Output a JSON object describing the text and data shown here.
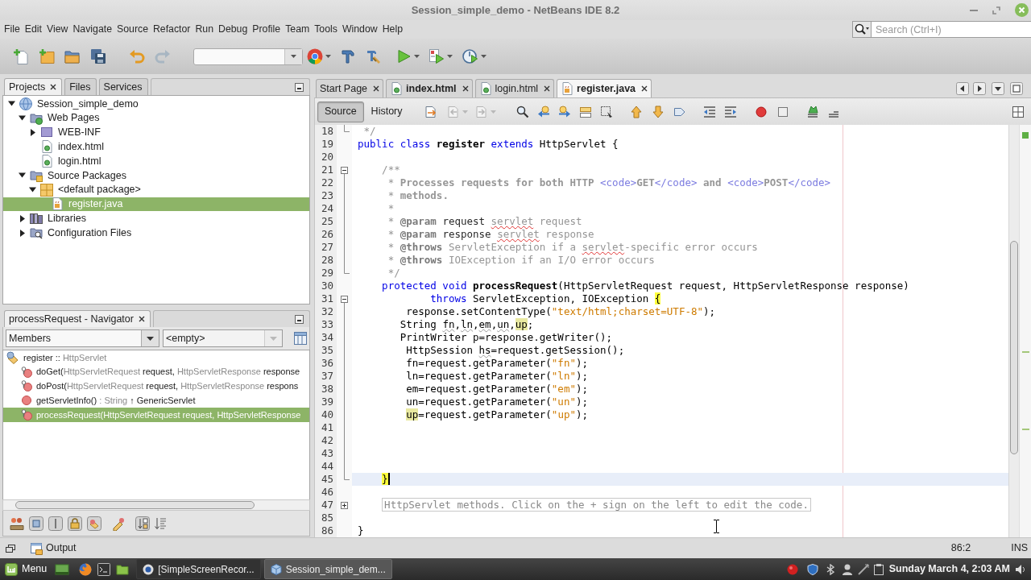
{
  "window": {
    "title": "Session_simple_demo - NetBeans IDE 8.2"
  },
  "menu": [
    "File",
    "Edit",
    "View",
    "Navigate",
    "Source",
    "Refactor",
    "Run",
    "Debug",
    "Profile",
    "Team",
    "Tools",
    "Window",
    "Help"
  ],
  "search": {
    "placeholder": "Search (Ctrl+I)"
  },
  "projects": {
    "tabs": [
      {
        "label": "Projects",
        "selected": true
      },
      {
        "label": "Files",
        "selected": false
      },
      {
        "label": "Services",
        "selected": false
      }
    ],
    "tree": [
      {
        "label": "Session_simple_demo",
        "kind": "project",
        "expanded": true,
        "selected": false,
        "children": [
          {
            "label": "Web Pages",
            "kind": "web_pages",
            "expanded": true,
            "selected": false,
            "children": [
              {
                "label": "WEB-INF",
                "kind": "folder",
                "expanded": false,
                "selected": false
              },
              {
                "label": "index.html",
                "kind": "html",
                "selected": false
              },
              {
                "label": "login.html",
                "kind": "html",
                "selected": false
              }
            ]
          },
          {
            "label": "Source Packages",
            "kind": "source_packages",
            "expanded": true,
            "selected": false,
            "children": [
              {
                "label": "<default package>",
                "kind": "package",
                "expanded": true,
                "selected": false,
                "children": [
                  {
                    "label": "register.java",
                    "kind": "java",
                    "selected": true
                  }
                ]
              }
            ]
          },
          {
            "label": "Libraries",
            "kind": "libraries",
            "expanded": false,
            "selected": false
          },
          {
            "label": "Configuration Files",
            "kind": "config",
            "expanded": false,
            "selected": false
          }
        ]
      }
    ]
  },
  "navigator": {
    "title": "processRequest - Navigator",
    "filter": {
      "value": "Members"
    },
    "scope": {
      "value": "<empty>",
      "disabled": true
    },
    "items": [
      {
        "kind": "class",
        "selected": false,
        "parts": [
          {
            "text": "register :: ",
            "kind": "name"
          },
          {
            "text": "HttpServlet",
            "kind": "type"
          }
        ],
        "children": [
          {
            "kind": "protected_method",
            "selected": false,
            "parts": [
              {
                "text": "doGet(",
                "kind": "name"
              },
              {
                "text": "HttpServletRequest",
                "kind": "type"
              },
              {
                "text": " request, ",
                "kind": "name"
              },
              {
                "text": "HttpServletResponse",
                "kind": "type"
              },
              {
                "text": " response",
                "kind": "name"
              }
            ]
          },
          {
            "kind": "protected_method",
            "selected": false,
            "parts": [
              {
                "text": "doPost(",
                "kind": "name"
              },
              {
                "text": "HttpServletRequest",
                "kind": "type"
              },
              {
                "text": " request, ",
                "kind": "name"
              },
              {
                "text": "HttpServletResponse",
                "kind": "type"
              },
              {
                "text": " respons",
                "kind": "name"
              }
            ]
          },
          {
            "kind": "public_method",
            "selected": false,
            "parts": [
              {
                "text": "getServletInfo() ",
                "kind": "name"
              },
              {
                "text": ": String ",
                "kind": "type"
              },
              {
                "text": "↑ GenericServlet",
                "kind": "name"
              }
            ]
          },
          {
            "kind": "protected_method",
            "selected": true,
            "parts": [
              {
                "text": "processRequest(",
                "kind": "name"
              },
              {
                "text": "HttpServletRequest",
                "kind": "type"
              },
              {
                "text": " request, ",
                "kind": "name"
              },
              {
                "text": "HttpServletResponse",
                "kind": "type"
              }
            ]
          }
        ]
      }
    ]
  },
  "editor": {
    "tabs": [
      {
        "label": "Start Page",
        "kind": "page",
        "selected": false,
        "modified": false
      },
      {
        "label": "index.html",
        "kind": "html",
        "selected": false,
        "modified": true
      },
      {
        "label": "login.html",
        "kind": "html",
        "selected": false,
        "modified": false
      },
      {
        "label": "register.java",
        "kind": "java",
        "selected": true,
        "modified": true
      }
    ],
    "views": [
      {
        "label": "Source",
        "selected": true
      },
      {
        "label": "History",
        "selected": false
      }
    ],
    "lines": [
      {
        "number": "18",
        "kind": "fold_end",
        "current": false,
        "tokens": [
          {
            "text": " */",
            "kind": "comment"
          }
        ]
      },
      {
        "number": "19",
        "kind": "code",
        "current": false,
        "tokens": [
          {
            "text": "public class ",
            "kind": "keyword"
          },
          {
            "text": "register",
            "kind": "decl"
          },
          {
            "text": " extends ",
            "kind": "keyword"
          },
          {
            "text": "HttpServlet {",
            "kind": "plain"
          }
        ]
      },
      {
        "number": "20",
        "kind": "code",
        "current": false
      },
      {
        "number": "21",
        "kind": "fold_start",
        "current": false,
        "tokens": [
          {
            "text": "    /**",
            "kind": "comment"
          }
        ]
      },
      {
        "number": "22",
        "kind": "code",
        "current": false,
        "tokens": [
          {
            "text": "     * ",
            "kind": "comment"
          },
          {
            "text": "Processes requests for both HTTP ",
            "kind": "comment_bold"
          },
          {
            "text": "<code>",
            "kind": "html_tag"
          },
          {
            "text": "GET",
            "kind": "comment_bold"
          },
          {
            "text": "</code>",
            "kind": "html_tag"
          },
          {
            "text": " and ",
            "kind": "comment_bold"
          },
          {
            "text": "<code>",
            "kind": "html_tag"
          },
          {
            "text": "POST",
            "kind": "comment_bold"
          },
          {
            "text": "</code>",
            "kind": "html_tag"
          }
        ]
      },
      {
        "number": "23",
        "kind": "code",
        "current": false,
        "tokens": [
          {
            "text": "     * ",
            "kind": "comment"
          },
          {
            "text": "methods.",
            "kind": "comment_bold"
          }
        ]
      },
      {
        "number": "24",
        "kind": "code",
        "current": false,
        "tokens": [
          {
            "text": "     *",
            "kind": "comment"
          }
        ]
      },
      {
        "number": "25",
        "kind": "code",
        "current": false,
        "tokens": [
          {
            "text": "     * ",
            "kind": "comment"
          },
          {
            "text": "@param",
            "kind": "doc_tag"
          },
          {
            "text": " request ",
            "kind": "doc_param"
          },
          {
            "text": "servlet",
            "kind": "misspelled"
          },
          {
            "text": " request",
            "kind": "comment"
          }
        ]
      },
      {
        "number": "26",
        "kind": "code",
        "current": false,
        "tokens": [
          {
            "text": "     * ",
            "kind": "comment"
          },
          {
            "text": "@param",
            "kind": "doc_tag"
          },
          {
            "text": " response ",
            "kind": "doc_param"
          },
          {
            "text": "servlet",
            "kind": "misspelled"
          },
          {
            "text": " response",
            "kind": "comment"
          }
        ]
      },
      {
        "number": "27",
        "kind": "code",
        "current": false,
        "tokens": [
          {
            "text": "     * ",
            "kind": "comment"
          },
          {
            "text": "@throws",
            "kind": "doc_tag"
          },
          {
            "text": " ServletException if a ",
            "kind": "comment"
          },
          {
            "text": "servlet",
            "kind": "misspelled"
          },
          {
            "text": "-specific error occurs",
            "kind": "comment"
          }
        ]
      },
      {
        "number": "28",
        "kind": "code",
        "current": false,
        "tokens": [
          {
            "text": "     * ",
            "kind": "comment"
          },
          {
            "text": "@throws",
            "kind": "doc_tag"
          },
          {
            "text": " IOException if an I/O error occurs",
            "kind": "comment"
          }
        ]
      },
      {
        "number": "29",
        "kind": "fold_end",
        "current": false,
        "tokens": [
          {
            "text": "     */",
            "kind": "comment"
          }
        ]
      },
      {
        "number": "30",
        "kind": "code",
        "current": false,
        "tokens": [
          {
            "text": "    protected void ",
            "kind": "keyword"
          },
          {
            "text": "processRequest",
            "kind": "decl"
          },
          {
            "text": "(HttpServletRequest request, HttpServletResponse response)",
            "kind": "plain"
          }
        ]
      },
      {
        "number": "31",
        "kind": "fold_start",
        "current": false,
        "tokens": [
          {
            "text": "            throws",
            "kind": "keyword"
          },
          {
            "text": " ServletException, IOException ",
            "kind": "plain"
          },
          {
            "text": "{",
            "kind": "brace"
          }
        ]
      },
      {
        "number": "32",
        "kind": "code",
        "current": false,
        "tokens": [
          {
            "text": "        response.setContentType(",
            "kind": "plain"
          },
          {
            "text": "\"text/html;charset=UTF-8\"",
            "kind": "string"
          },
          {
            "text": ");",
            "kind": "plain"
          }
        ]
      },
      {
        "number": "33",
        "kind": "code",
        "current": false,
        "tokens": [
          {
            "text": "       String ",
            "kind": "plain"
          },
          {
            "text": "fn",
            "kind": "unused"
          },
          {
            "text": ",",
            "kind": "plain"
          },
          {
            "text": "ln",
            "kind": "unused"
          },
          {
            "text": ",",
            "kind": "plain"
          },
          {
            "text": "em",
            "kind": "unused"
          },
          {
            "text": ",",
            "kind": "plain"
          },
          {
            "text": "un",
            "kind": "unused"
          },
          {
            "text": ",",
            "kind": "plain"
          },
          {
            "text": "up",
            "kind": "occurrence"
          },
          {
            "text": ";",
            "kind": "plain"
          }
        ]
      },
      {
        "number": "34",
        "kind": "code",
        "current": false,
        "tokens": [
          {
            "text": "       PrintWriter p=response.getWriter();",
            "kind": "plain"
          }
        ]
      },
      {
        "number": "35",
        "kind": "code",
        "current": false,
        "tokens": [
          {
            "text": "        HttpSession ",
            "kind": "plain"
          },
          {
            "text": "hs",
            "kind": "unused"
          },
          {
            "text": "=request.getSession();",
            "kind": "plain"
          }
        ]
      },
      {
        "number": "36",
        "kind": "code",
        "current": false,
        "tokens": [
          {
            "text": "        fn=request.getParameter(",
            "kind": "plain"
          },
          {
            "text": "\"fn\"",
            "kind": "string"
          },
          {
            "text": ");",
            "kind": "plain"
          }
        ]
      },
      {
        "number": "37",
        "kind": "code",
        "current": false,
        "tokens": [
          {
            "text": "        ln=request.getParameter(",
            "kind": "plain"
          },
          {
            "text": "\"ln\"",
            "kind": "string"
          },
          {
            "text": ");",
            "kind": "plain"
          }
        ]
      },
      {
        "number": "38",
        "kind": "code",
        "current": false,
        "tokens": [
          {
            "text": "        em=request.getParameter(",
            "kind": "plain"
          },
          {
            "text": "\"em\"",
            "kind": "string"
          },
          {
            "text": ");",
            "kind": "plain"
          }
        ]
      },
      {
        "number": "39",
        "kind": "code",
        "current": false,
        "tokens": [
          {
            "text": "        un=request.getParameter(",
            "kind": "plain"
          },
          {
            "text": "\"un\"",
            "kind": "string"
          },
          {
            "text": ");",
            "kind": "plain"
          }
        ]
      },
      {
        "number": "40",
        "kind": "code",
        "current": false,
        "tokens": [
          {
            "text": "        up",
            "kind": "occurrence"
          },
          {
            "text": "=request.getParameter(",
            "kind": "plain"
          },
          {
            "text": "\"up\"",
            "kind": "string"
          },
          {
            "text": ");",
            "kind": "plain"
          }
        ]
      },
      {
        "number": "41",
        "kind": "code",
        "current": false
      },
      {
        "number": "42",
        "kind": "code",
        "current": false
      },
      {
        "number": "43",
        "kind": "code",
        "current": false
      },
      {
        "number": "44",
        "kind": "code",
        "current": false
      },
      {
        "number": "45",
        "kind": "fold_end",
        "current": true,
        "tokens": [
          {
            "text": "    }",
            "kind": "brace"
          }
        ]
      },
      {
        "number": "46",
        "kind": "code",
        "current": false
      },
      {
        "number": "47",
        "kind": "fold_collapsed",
        "current": false,
        "tokens": [
          {
            "text": "    HttpServlet methods. Click on the + sign on the left to edit the code.",
            "kind": "folded"
          }
        ]
      },
      {
        "number": "85",
        "kind": "code",
        "current": false
      },
      {
        "number": "86",
        "kind": "code",
        "current": false,
        "tokens": [
          {
            "text": "}",
            "kind": "plain"
          }
        ]
      }
    ]
  },
  "output": {
    "label": "Output"
  },
  "status_bar": {
    "position": "86:2",
    "mode": "INS"
  },
  "taskbar": {
    "menu": "Menu",
    "tasks": [
      {
        "label": "[SimpleScreenRecor...",
        "kind": "recorder",
        "selected": false
      },
      {
        "label": "Session_simple_dem...",
        "kind": "ide",
        "selected": true
      }
    ],
    "clock": "Sunday March 4, 2:03 AM"
  }
}
